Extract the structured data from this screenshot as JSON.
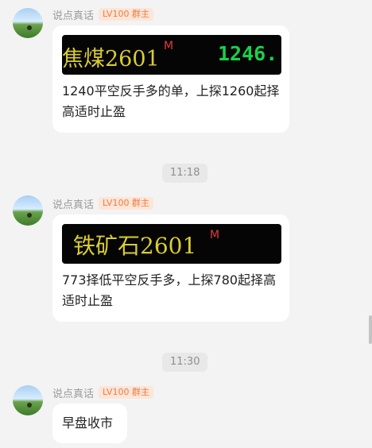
{
  "messages": [
    {
      "sender": "说点真话",
      "badge": "LV100 群主",
      "avatar": "landscape-avatar",
      "image_banner": {
        "name": "焦煤2601",
        "mark": "M",
        "price": "1246.."
      },
      "text": "1240平空反手多的单，上探1260起择高适时止盈"
    },
    {
      "sender": "说点真话",
      "badge": "LV100 群主",
      "avatar": "landscape-avatar",
      "image_banner": {
        "name": "铁矿石2601",
        "mark": "M"
      },
      "text": "773择低平空反手多，上探780起择高适时止盈"
    },
    {
      "sender": "说点真话",
      "badge": "LV100 群主",
      "avatar": "landscape-avatar",
      "text": "早盘收市"
    }
  ],
  "timestamps": [
    "11:18",
    "11:30"
  ],
  "colors": {
    "background": "#f3f3f3",
    "bubble": "#ffffff",
    "badge_bg": "#fde5d8",
    "badge_text": "#f27a40",
    "banner_title": "#d9cc32",
    "banner_price": "#17d24a",
    "banner_mark": "#e23a3a"
  }
}
